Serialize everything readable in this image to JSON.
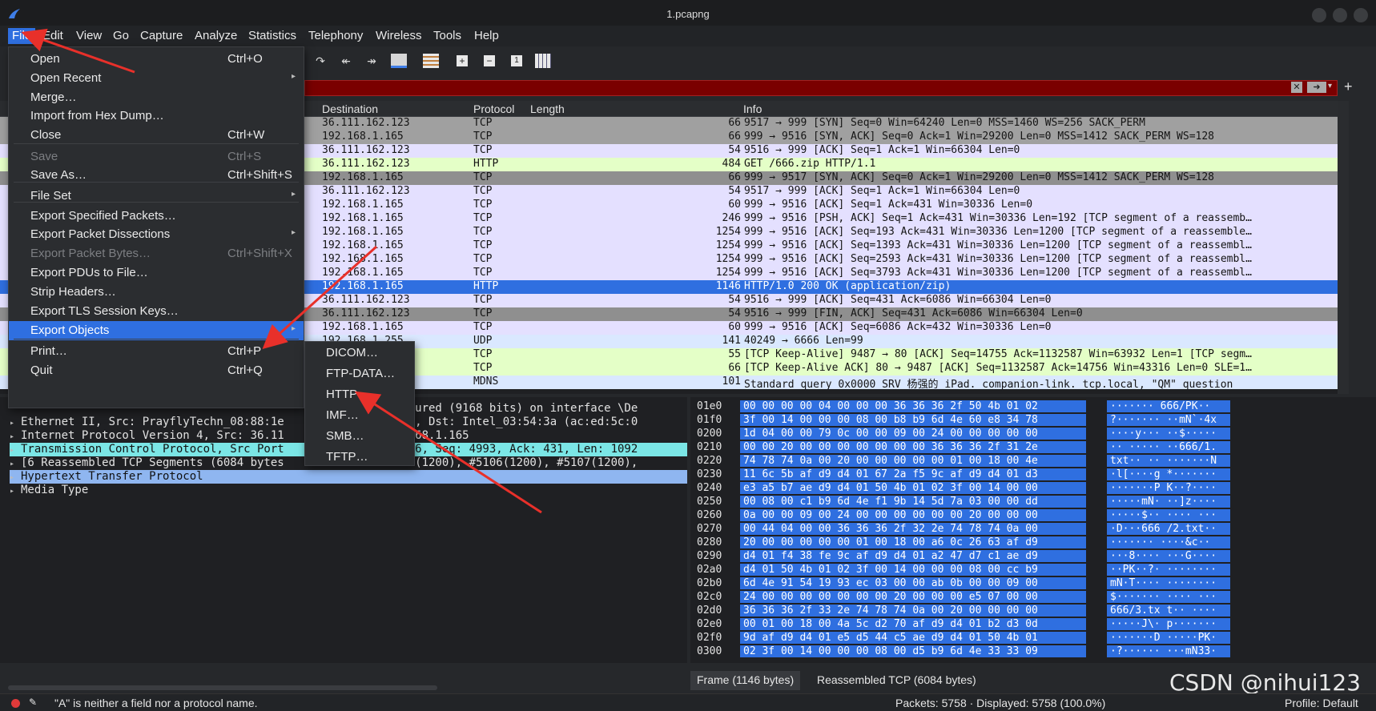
{
  "window": {
    "title": "1.pcapng"
  },
  "menubar": [
    "File",
    "Edit",
    "View",
    "Go",
    "Capture",
    "Analyze",
    "Statistics",
    "Telephony",
    "Wireless",
    "Tools",
    "Help"
  ],
  "packet_list": {
    "columns": [
      "Destination",
      "Protocol",
      "Length",
      "Info"
    ],
    "rows": [
      {
        "dst": "36.111.162.123",
        "proto": "TCP",
        "len": "66",
        "info": "9517 → 999 [SYN] Seq=0 Win=64240 Len=0 MSS=1460 WS=256 SACK_PERM",
        "style": "c-grey"
      },
      {
        "dst": "192.168.1.165",
        "proto": "TCP",
        "len": "66",
        "info": "999 → 9516 [SYN, ACK] Seq=0 Ack=1 Win=29200 Len=0 MSS=1412 SACK_PERM WS=128",
        "style": "c-grey"
      },
      {
        "dst": "36.111.162.123",
        "proto": "TCP",
        "len": "54",
        "info": "9516 → 999 [ACK] Seq=1 Ack=1 Win=66304 Len=0",
        "style": "c-lav"
      },
      {
        "dst": "36.111.162.123",
        "proto": "HTTP",
        "len": "484",
        "info": "GET /666.zip HTTP/1.1",
        "style": "c-green"
      },
      {
        "dst": "192.168.1.165",
        "proto": "TCP",
        "len": "66",
        "info": "999 → 9517 [SYN, ACK] Seq=0 Ack=1 Win=29200 Len=0 MSS=1412 SACK_PERM WS=128",
        "style": "c-dark"
      },
      {
        "dst": "36.111.162.123",
        "proto": "TCP",
        "len": "54",
        "info": "9517 → 999 [ACK] Seq=1 Ack=1 Win=66304 Len=0",
        "style": "c-lav"
      },
      {
        "dst": "192.168.1.165",
        "proto": "TCP",
        "len": "60",
        "info": "999 → 9516 [ACK] Seq=1 Ack=431 Win=30336 Len=0",
        "style": "c-lav"
      },
      {
        "dst": "192.168.1.165",
        "proto": "TCP",
        "len": "246",
        "info": "999 → 9516 [PSH, ACK] Seq=1 Ack=431 Win=30336 Len=192 [TCP segment of a reassemb…",
        "style": "c-lav"
      },
      {
        "dst": "192.168.1.165",
        "proto": "TCP",
        "len": "1254",
        "info": "999 → 9516 [ACK] Seq=193 Ack=431 Win=30336 Len=1200 [TCP segment of a reassemble…",
        "style": "c-lav"
      },
      {
        "dst": "192.168.1.165",
        "proto": "TCP",
        "len": "1254",
        "info": "999 → 9516 [ACK] Seq=1393 Ack=431 Win=30336 Len=1200 [TCP segment of a reassembl…",
        "style": "c-lav"
      },
      {
        "dst": "192.168.1.165",
        "proto": "TCP",
        "len": "1254",
        "info": "999 → 9516 [ACK] Seq=2593 Ack=431 Win=30336 Len=1200 [TCP segment of a reassembl…",
        "style": "c-lav"
      },
      {
        "dst": "192.168.1.165",
        "proto": "TCP",
        "len": "1254",
        "info": "999 → 9516 [ACK] Seq=3793 Ack=431 Win=30336 Len=1200 [TCP segment of a reassembl…",
        "style": "c-lav"
      },
      {
        "dst": "192.168.1.165",
        "proto": "HTTP",
        "len": "1146",
        "info": "HTTP/1.0 200 OK  (application/zip)",
        "style": "c-sel"
      },
      {
        "dst": "36.111.162.123",
        "proto": "TCP",
        "len": "54",
        "info": "9516 → 999 [ACK] Seq=431 Ack=6086 Win=66304 Len=0",
        "style": "c-lav"
      },
      {
        "dst": "36.111.162.123",
        "proto": "TCP",
        "len": "54",
        "info": "9516 → 999 [FIN, ACK] Seq=431 Ack=6086 Win=66304 Len=0",
        "style": "c-dark"
      },
      {
        "dst": "192.168.1.165",
        "proto": "TCP",
        "len": "60",
        "info": "999 → 9516 [ACK] Seq=6086 Ack=432 Win=30336 Len=0",
        "style": "c-lav"
      },
      {
        "dst": "192.168.1.255",
        "proto": "UDP",
        "len": "141",
        "info": "40249 → 6666 Len=99",
        "style": "c-udp"
      },
      {
        "dst": "…47",
        "proto": "TCP",
        "len": "55",
        "info": "[TCP Keep-Alive] 9487 → 80 [ACK] Seq=14755 Ack=1132587 Win=63932 Len=1 [TCP segm…",
        "style": "c-keep"
      },
      {
        "dst": "…5",
        "proto": "TCP",
        "len": "66",
        "info": "[TCP Keep-Alive ACK] 80 → 9487 [ACK] Seq=1132587 Ack=14756 Win=43316 Len=0 SLE=1…",
        "style": "c-keep"
      },
      {
        "dst": "",
        "proto": "MDNS",
        "len": "101",
        "info": "Standard query 0x0000 SRV 杨强的 iPad._companion-link._tcp.local, \"QM\" question",
        "style": "c-udp"
      }
    ]
  },
  "details": [
    {
      "text": "…captured (9168 bits) on interface \\De",
      "style": "",
      "indent": 476
    },
    {
      "text": "Ethernet II, Src: PrayflyTechn_08:88:1e",
      "tail": "8:1e), Dst: Intel_03:54:3a (ac:ed:5c:0",
      "style": ""
    },
    {
      "text": "Internet Protocol Version 4, Src: 36.11",
      "tail": "192.168.1.165",
      "style": ""
    },
    {
      "text": "Transmission Control Protocol, Src Port",
      "tail": ": 9516, Seq: 4993, Ack: 431, Len: 1092",
      "style": "hl-cyan"
    },
    {
      "text": "[6 Reassembled TCP Segments (6084 bytes",
      "tail": "#5105(1200), #5106(1200), #5107(1200),",
      "style": ""
    },
    {
      "text": "Hypertext Transfer Protocol",
      "tail": "",
      "style": "hl-blue"
    },
    {
      "text": "Media Type",
      "tail": "",
      "style": ""
    }
  ],
  "hex": [
    {
      "off": "01e0",
      "hex": "00 00 00 00 04 00 00 00  36 36 36 2f 50 4b 01 02",
      "asc": "······· 666/PK··"
    },
    {
      "off": "01f0",
      "hex": "3f 00 14 00 00 00 08 00  b8 b9 6d 4e 60 e8 34 78",
      "asc": "?······· ··mN`·4x"
    },
    {
      "off": "0200",
      "hex": "1d 04 00 00 79 0c 00 00  09 00 24 00 00 00 00 00",
      "asc": "····y··· ··$·····"
    },
    {
      "off": "0210",
      "hex": "00 00 20 00 00 00 00 00  00 00 36 36 36 2f 31 2e",
      "asc": "·· ····· ··666/1."
    },
    {
      "off": "0220",
      "hex": "74 78 74 0a 00 20 00 00  00 00 00 01 00 18 00 4e",
      "asc": "txt·· ·· ·······N"
    },
    {
      "off": "0230",
      "hex": "11 6c 5b af d9 d4 01 67  2a f5 9c af d9 d4 01 d3",
      "asc": "·l[····g *·······"
    },
    {
      "off": "0240",
      "hex": "e3 a5 b7 ae d9 d4 01 50  4b 01 02 3f 00 14 00 00",
      "asc": "·······P K··?····"
    },
    {
      "off": "0250",
      "hex": "00 08 00 c1 b9 6d 4e f1  9b 14 5d 7a 03 00 00 dd",
      "asc": "·····mN· ··]z····"
    },
    {
      "off": "0260",
      "hex": "0a 00 00 09 00 24 00 00  00 00 00 00 20 00 00 00",
      "asc": "·····$·· ···· ···"
    },
    {
      "off": "0270",
      "hex": "00 44 04 00 00 36 36 36  2f 32 2e 74 78 74 0a 00",
      "asc": "·D···666 /2.txt··"
    },
    {
      "off": "0280",
      "hex": "20 00 00 00 00 00 01 00  18 00 a6 0c 26 63 af d9",
      "asc": " ······· ····&c··"
    },
    {
      "off": "0290",
      "hex": "d4 01 f4 38 fe 9c af d9  d4 01 a2 47 d7 c1 ae d9",
      "asc": "···8···· ···G····"
    },
    {
      "off": "02a0",
      "hex": "d4 01 50 4b 01 02 3f 00  14 00 00 00 08 00 cc b9",
      "asc": "··PK··?· ········"
    },
    {
      "off": "02b0",
      "hex": "6d 4e 91 54 19 93 ec 03  00 00 ab 0b 00 00 09 00",
      "asc": "mN·T···· ········"
    },
    {
      "off": "02c0",
      "hex": "24 00 00 00 00 00 00 00  20 00 00 00 e5 07 00 00",
      "asc": "$······· ···· ···"
    },
    {
      "off": "02d0",
      "hex": "36 36 36 2f 33 2e 74 78  74 0a 00 20 00 00 00 00",
      "asc": "666/3.tx t·· ····"
    },
    {
      "off": "02e0",
      "hex": "00 01 00 18 00 4a 5c d2  70 af d9 d4 01 b2 d3 0d",
      "asc": "·····J\\· p·······"
    },
    {
      "off": "02f0",
      "hex": "9d af d9 d4 01 e5 d5 44  c5 ae d9 d4 01 50 4b 01",
      "asc": "·······D ·····PK·"
    },
    {
      "off": "0300",
      "hex": "02 3f 00 14 00 00 00 08  00 d5 b9 6d 4e 33 33 09",
      "asc": "·?······ ···mN33·"
    }
  ],
  "bottom_tabs": [
    "Frame (1146 bytes)",
    "Reassembled TCP (6084 bytes)"
  ],
  "status": {
    "message": "\"A\" is neither a field nor a protocol name.",
    "packets": "Packets: 5758 · Displayed: 5758 (100.0%)",
    "profile": "Profile: Default"
  },
  "watermark": "CSDN @nihui123",
  "file_menu": [
    {
      "label": "Open",
      "shortcut": "Ctrl+O"
    },
    {
      "label": "Open Recent",
      "submenu": true
    },
    {
      "label": "Merge…"
    },
    {
      "label": "Import from Hex Dump…"
    },
    {
      "label": "Close",
      "shortcut": "Ctrl+W"
    },
    {
      "label": "Save",
      "shortcut": "Ctrl+S",
      "disabled": true
    },
    {
      "label": "Save As…",
      "shortcut": "Ctrl+Shift+S"
    },
    {
      "label": "File Set",
      "submenu": true
    },
    {
      "label": "Export Specified Packets…"
    },
    {
      "label": "Export Packet Dissections",
      "submenu": true
    },
    {
      "label": "Export Packet Bytes…",
      "shortcut": "Ctrl+Shift+X",
      "disabled": true
    },
    {
      "label": "Export PDUs to File…"
    },
    {
      "label": "Strip Headers…"
    },
    {
      "label": "Export TLS Session Keys…"
    },
    {
      "label": "Export Objects",
      "submenu": true,
      "highlight": true
    },
    {
      "label": "Print…",
      "shortcut": "Ctrl+P"
    },
    {
      "label": "Quit",
      "shortcut": "Ctrl+Q"
    }
  ],
  "export_objects_menu": [
    "DICOM…",
    "FTP-DATA…",
    "HTTP…",
    "IMF…",
    "SMB…",
    "TFTP…"
  ],
  "colors": {
    "accent": "#2f6fe0",
    "filter_error": "#7a0000",
    "arrow": "#e8302a"
  }
}
